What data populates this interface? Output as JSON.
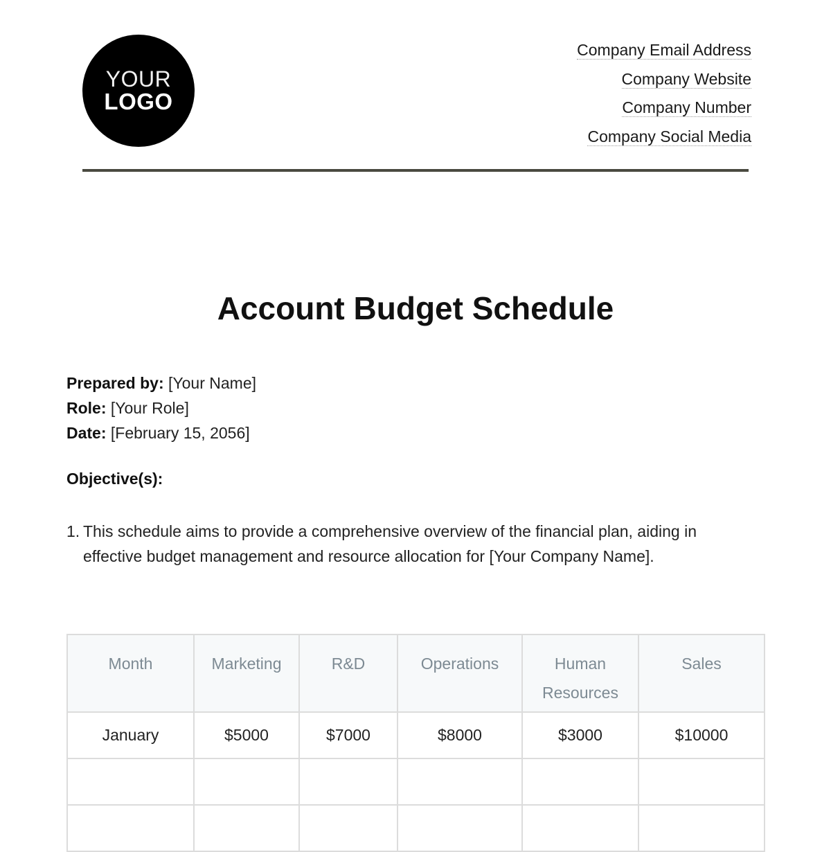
{
  "logo": {
    "line1": "YOUR",
    "line2": "LOGO"
  },
  "contact": [
    "Company Email Address",
    "Company Website",
    "Company Number",
    "Company Social Media"
  ],
  "title": "Account Budget Schedule",
  "meta": {
    "prepared_by_label": "Prepared by:",
    "prepared_by_value": "[Your Name]",
    "role_label": "Role:",
    "role_value": "[Your Role]",
    "date_label": "Date:",
    "date_value": "[February 15, 2056]"
  },
  "objectives": {
    "heading": "Objective(s):",
    "items": [
      {
        "number": "1.",
        "text": "This schedule aims to provide a comprehensive overview of the financial plan, aiding in effective budget management and resource allocation for [Your Company Name]."
      }
    ]
  },
  "table": {
    "headers": [
      "Month",
      "Marketing",
      "R&D",
      "Operations",
      "Human Resources",
      "Sales"
    ],
    "rows": [
      [
        "January",
        "$5000",
        "$7000",
        "$8000",
        "$3000",
        "$10000"
      ],
      [
        "",
        "",
        "",
        "",
        "",
        ""
      ],
      [
        "",
        "",
        "",
        "",
        "",
        ""
      ]
    ]
  }
}
